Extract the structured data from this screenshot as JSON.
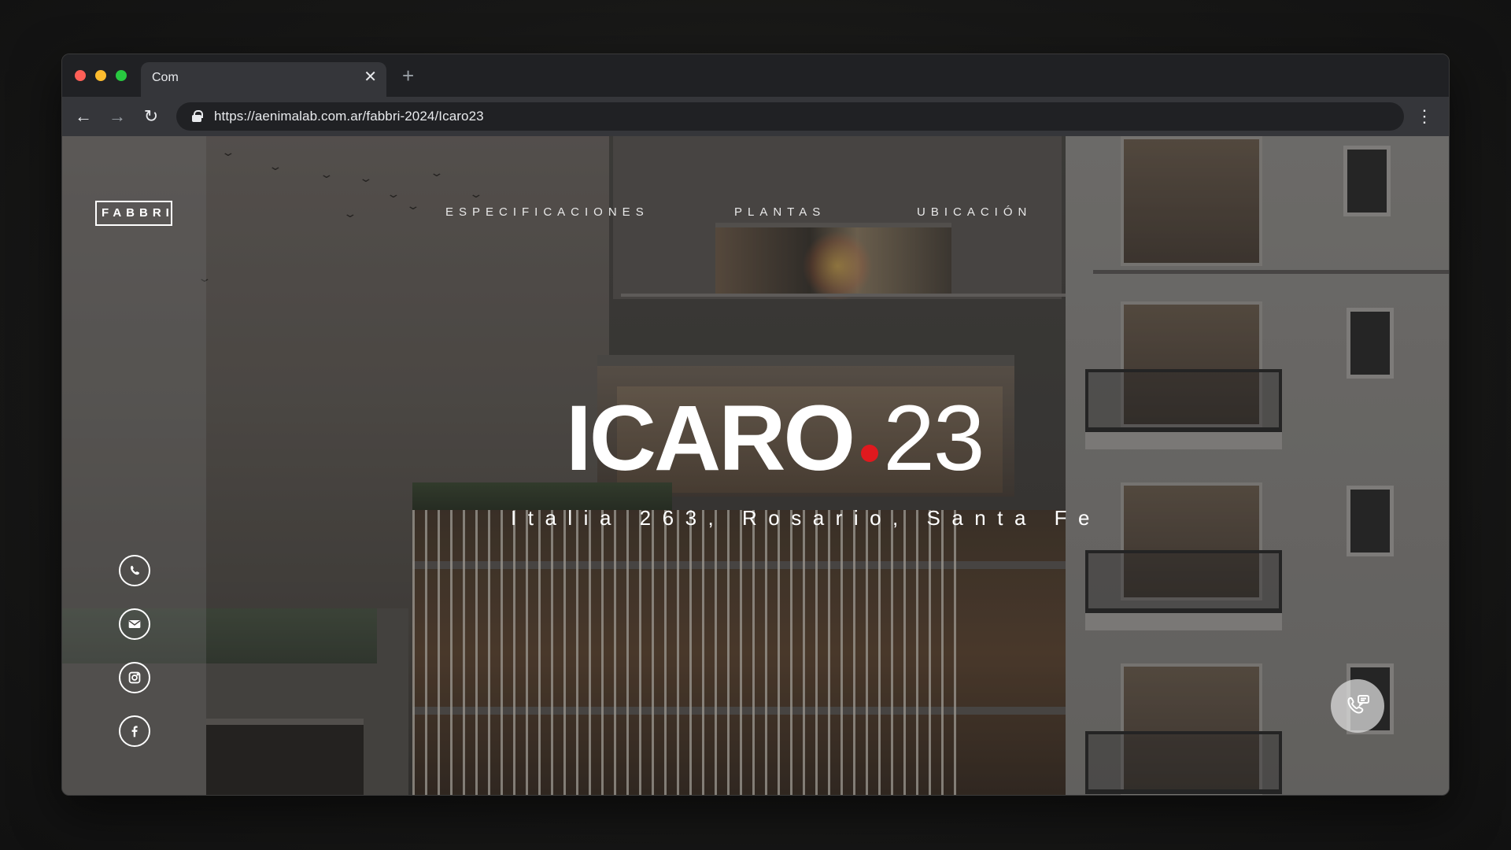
{
  "browser": {
    "tab_title": "Com",
    "close_glyph": "✕",
    "new_tab_glyph": "+",
    "url": "https://aenimalab.com.ar/fabbri-2024/Icaro23",
    "back_glyph": "←",
    "forward_glyph": "→",
    "reload_glyph": "↻",
    "menu_glyph": "⋮"
  },
  "site": {
    "logo": "FABBRI",
    "nav": [
      "ESPECIFICACIONES",
      "PLANTAS",
      "UBICACIÓN"
    ],
    "hero": {
      "title_bold": "ICARO",
      "title_number": "23",
      "subtitle": "Italia 263, Rosario, Santa Fe",
      "accent_color": "#e0191e"
    },
    "social_icons": [
      "whatsapp-icon",
      "email-icon",
      "instagram-icon",
      "facebook-icon"
    ],
    "call_button_icon": "phone-chat-icon"
  }
}
